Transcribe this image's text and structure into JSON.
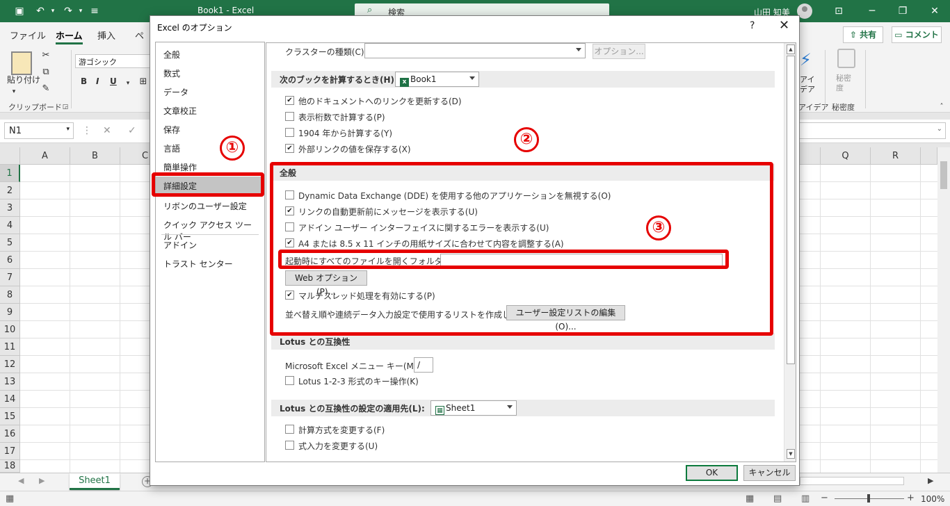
{
  "app": {
    "doc_title": "Book1  -  Excel",
    "search_placeholder": "検索",
    "user_name": "山田 知美"
  },
  "ribbon": {
    "tabs": [
      "ファイル",
      "ホーム",
      "挿入",
      "ペ"
    ],
    "share_label": "共有",
    "comment_label": "コメント",
    "paste_label": "貼り付け",
    "clipboard_group": "クリップボード",
    "font_name": "游ゴシック",
    "bold": "B",
    "italic": "I",
    "underline": "U",
    "idea_label": "アイ\nデア",
    "idea_group": "アイデア",
    "sensitivity_label": "秘密\n度",
    "sensitivity_group": "秘密度"
  },
  "formula_bar": {
    "name_box": "N1"
  },
  "grid": {
    "columns_left": [
      "A",
      "B",
      "C"
    ],
    "columns_right": [
      "Q",
      "R"
    ],
    "rows": [
      "1",
      "2",
      "3",
      "4",
      "5",
      "6",
      "7",
      "8",
      "9",
      "10",
      "11",
      "12",
      "13",
      "14",
      "15",
      "16",
      "17",
      "18"
    ]
  },
  "sheets": {
    "tabs": [
      "Sheet1"
    ]
  },
  "status": {
    "zoom": "100%"
  },
  "dialog": {
    "title": "Excel のオプション",
    "help": "?",
    "nav_items": [
      "全般",
      "数式",
      "データ",
      "文章校正",
      "保存",
      "言語",
      "簡単操作",
      "詳細設定",
      "リボンのユーザー設定",
      "クイック アクセス ツール バー",
      "アドイン",
      "トラスト センター"
    ],
    "selected_nav": "詳細設定",
    "cluster_label": "クラスターの種類(C):",
    "options_button": "オプション...",
    "calc_section": {
      "label": "次のブックを計算するとき(H):",
      "book_value": "Book1",
      "items": [
        {
          "label": "他のドキュメントへのリンクを更新する(D)",
          "checked": true
        },
        {
          "label": "表示桁数で計算する(P)",
          "checked": false
        },
        {
          "label": "1904 年から計算する(Y)",
          "checked": false
        },
        {
          "label": "外部リンクの値を保存する(X)",
          "checked": true
        }
      ]
    },
    "general_section": {
      "title": "全般",
      "items": [
        {
          "label": "Dynamic Data Exchange (DDE) を使用する他のアプリケーションを無視する(O)",
          "checked": false
        },
        {
          "label": "リンクの自動更新前にメッセージを表示する(U)",
          "checked": true
        },
        {
          "label": "アドイン ユーザー インターフェイスに関するエラーを表示する(U)",
          "checked": false
        },
        {
          "label": "A4 または 8.5 x 11 インチの用紙サイズに合わせて内容を調整する(A)",
          "checked": true
        }
      ],
      "startup_label": "起動時にすべてのファイルを開くフォルダー(L):",
      "startup_value": "",
      "web_options_button": "Web オプション(P)...",
      "multithread": {
        "label": "マルチスレッド処理を有効にする(P)",
        "checked": true
      },
      "sort_list_label": "並べ替え順や連続データ入力設定で使用するリストを作成します:",
      "edit_list_button": "ユーザー設定リストの編集(O)..."
    },
    "lotus_section": {
      "title": "Lotus との互換性",
      "menu_key_label": "Microsoft Excel メニュー キー(M):",
      "menu_key_value": "/",
      "key_nav": {
        "label": "Lotus 1-2-3 形式のキー操作(K)",
        "checked": false
      }
    },
    "lotus_settings_section": {
      "label": "Lotus との互換性の設定の適用先(L):",
      "sheet_value": "Sheet1",
      "items": [
        {
          "label": "計算方式を変更する(F)",
          "checked": false
        },
        {
          "label": "式入力を変更する(U)",
          "checked": false
        }
      ]
    },
    "ok_button": "OK",
    "cancel_button": "キャンセル"
  },
  "annotations": {
    "marker1": "①",
    "marker2": "②",
    "marker3": "③",
    "color": "#e60000"
  },
  "icons": {
    "save": "save-icon",
    "undo": "undo-icon",
    "redo": "redo-icon",
    "search": "search-icon",
    "check": "✔"
  }
}
